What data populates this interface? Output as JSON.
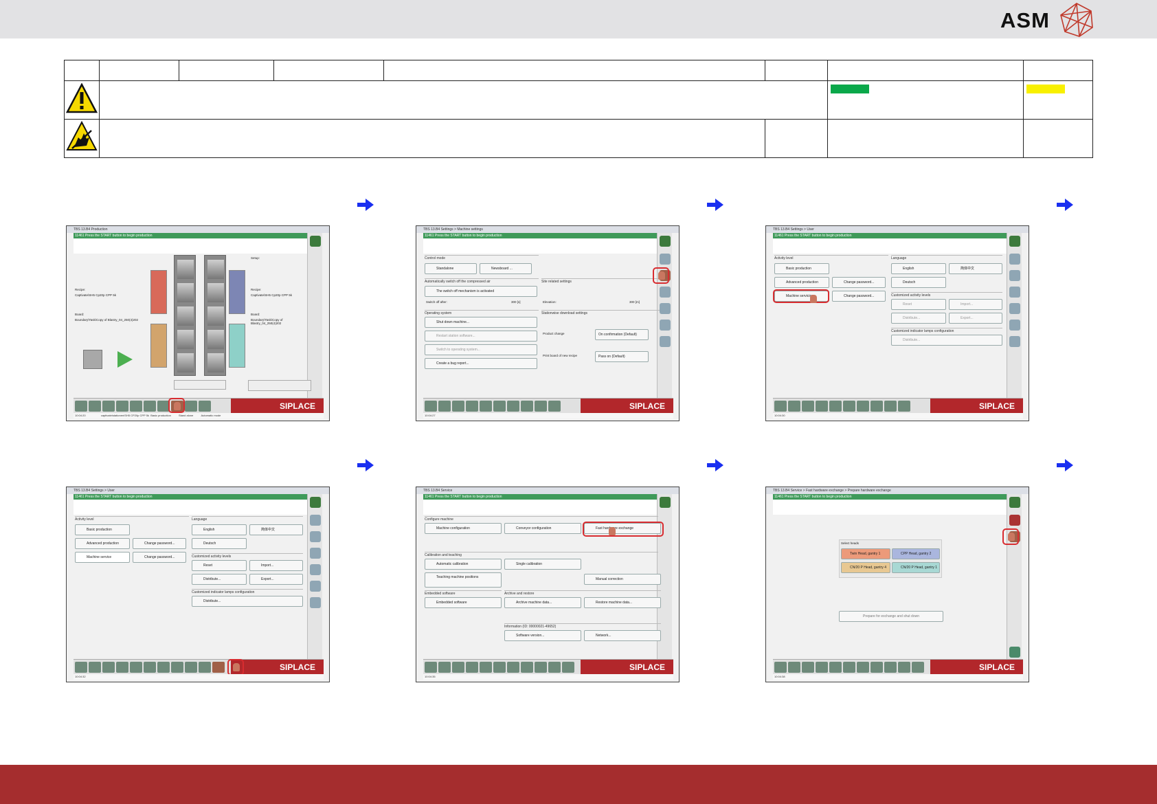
{
  "header": {
    "brand": "ASM"
  },
  "colors": {
    "footer": "#a52d2e",
    "green_bar": "#0aa84a",
    "yellow_bar": "#f8f000",
    "siplace_red": "#b2272b",
    "arrow_blue": "#1a2ff0"
  },
  "screens": {
    "s1": {
      "title": "TBS 13.B4 Production",
      "status": "11461 Press the START button to begin production",
      "setup_label": "Setup:",
      "recipe_label": "Recipe:",
      "recipe_value_l": "Captivate\\SH5 Cp20p CPP 5k",
      "recipe_value_r": "Captivate\\SH5 Cp20p CPP 5k",
      "board_label": "Board:",
      "board_value_l": "Boundary\\Task\\Copy of Blastry_04_250(4)202",
      "board_value_r": "Boundary\\Task\\Copy of Blastry_04_250(4)202",
      "footer_time": "10:04:20",
      "footer_recipe": "captivate\\stationen\\SH5 CP20p CPP 5k",
      "footer_level": "Basic production",
      "footer_mode1": "Stand alone",
      "footer_mode2": "Automatic mode"
    },
    "s2": {
      "title": "TBS 13.B4 Settings > Machine settings",
      "status": "11461 Press the START button to begin production",
      "control_mode": "Control mode",
      "standalone": "Standalone",
      "newsboard": "Newsboard ...",
      "auto_switch": "Automatically switch off the compressed air",
      "switch_activated": "The switch off mechanism is activated",
      "switch_after": "Switch off after:",
      "switch_value": "300 [s]",
      "site_settings": "Site related settings",
      "elevation": "Elevation:",
      "elevation_value": "300 [m]",
      "operating_system": "Operating system",
      "shutdown": "Shut down machine...",
      "restart": "Restart station software...",
      "switch_os": "Switch to operating system...",
      "bug_report": "Create a bug report...",
      "download_settings": "Stationwise download settings",
      "product_change": "Product change",
      "product_change_value": "On confirmation (Default)",
      "print_board": "Print board of new recipe",
      "print_board_value": "Pass on (Default)",
      "footer_time": "10:04:27"
    },
    "s3": {
      "title": "TBS 13.B4 Settings > User",
      "status": "11461 Press the START button to begin production",
      "activity_level": "Activity level",
      "basic": "Basic production",
      "advanced": "Advanced production",
      "service": "Machine servicing",
      "change_pw": "Change password...",
      "language": "Language",
      "english": "English",
      "chinese": "简体中文",
      "deutsch": "Deutsch",
      "custom_levels": "Customized activity levels",
      "reset": "Reset",
      "import": "Import...",
      "distribute": "Distribute...",
      "export": "Export...",
      "lamps": "Customized indicator lamps configuration",
      "footer_time": "10:04:30"
    },
    "s4": {
      "service": "Machine service",
      "footer_time": "10:04:32"
    },
    "s5": {
      "title": "TBS 13.B4 Service",
      "configure": "Configure machine",
      "machine_config": "Machine configuration",
      "conveyor_config": "Conveyor configuration",
      "fast_hw": "Fast hardware exchange",
      "calibration": "Calibration and teaching",
      "auto_calib": "Automatic calibration",
      "single_calib": "Single calibration",
      "teaching": "Teaching machine positions",
      "manual_corr": "Manual correction",
      "embedded": "Embedded software",
      "embedded_btn": "Embedded software",
      "archive": "Archive and restore",
      "archive_btn": "Archive machine data...",
      "restore_btn": "Restore machine data...",
      "information": "Information (ID: 00000021-49652)",
      "sw_version": "Software version...",
      "network": "Network...",
      "footer_time": "10:04:35"
    },
    "s6": {
      "title": "TBS 13.B4 Service > Fast hardware exchange > Prepare hardware exchange",
      "select_heads": "Select heads",
      "h1": "Twin Head, gantry 1",
      "h2": "CPP Head, gantry 2",
      "h3": "CN/20 P Head, gantry 4",
      "h4": "CN/20 P Head, gantry 1",
      "prepare": "Prepare for exchange and shut down",
      "footer_time": "10:04:38"
    },
    "siplace": "SIPLACE"
  }
}
